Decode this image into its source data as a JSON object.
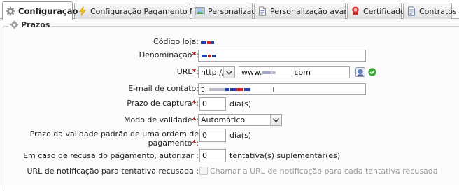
{
  "tabs": [
    {
      "id": "configuracao",
      "label": "Configuração",
      "icon": "gear-icon",
      "active": true
    },
    {
      "id": "pagamento-manual",
      "label": "Configuração Pagamento Manual",
      "icon": "lightning-icon",
      "active": false
    },
    {
      "id": "personalizacao",
      "label": "Personalização",
      "icon": "image-icon",
      "active": false
    },
    {
      "id": "personalizacao-avancada",
      "label": "Personalização avançada",
      "icon": "document-icon",
      "active": false
    },
    {
      "id": "certificados",
      "label": "Certificados",
      "icon": "ribbon-icon",
      "active": false
    },
    {
      "id": "contratos",
      "label": "Contratos",
      "icon": "contract-icon",
      "active": false
    }
  ],
  "section": {
    "title": "Prazos",
    "icon": "gear-icon"
  },
  "form": {
    "codigo_loja": {
      "label": "Código loja:",
      "value": ""
    },
    "denominacao": {
      "label": "Denominação",
      "value": ""
    },
    "url": {
      "label": "URL",
      "protocol": "http://",
      "value": "www.",
      "value_suffix": "com"
    },
    "email": {
      "label": "E-mail de contato:",
      "value": "t",
      "value_suffix": "ı"
    },
    "prazo_captura": {
      "label": "Prazo de captura",
      "value": "0",
      "unit": "dia(s)"
    },
    "modo_validade": {
      "label": "Modo de validade",
      "value": "Automático"
    },
    "prazo_validade": {
      "label_line1": "Prazo da validade padrão de uma ordem de",
      "label_line2": "pagamento",
      "value": "0",
      "unit": "dia(s)"
    },
    "recusa": {
      "label": "Em caso de recusa do pagamento, autorizar :",
      "value": "0",
      "unit": "tentativa(s) suplementar(es)"
    },
    "url_notificacao": {
      "label": "URL de notificação para tentativa recusada :",
      "checkbox_label": "Chamar a URL de notificação para cada tentativa recusada",
      "checked": false
    }
  },
  "required_mark": "*",
  "colors": {
    "required": "#d40000",
    "valid": "#3aa93a",
    "redaction_blue": "#1f3fb0",
    "redaction_red": "#d02020"
  }
}
